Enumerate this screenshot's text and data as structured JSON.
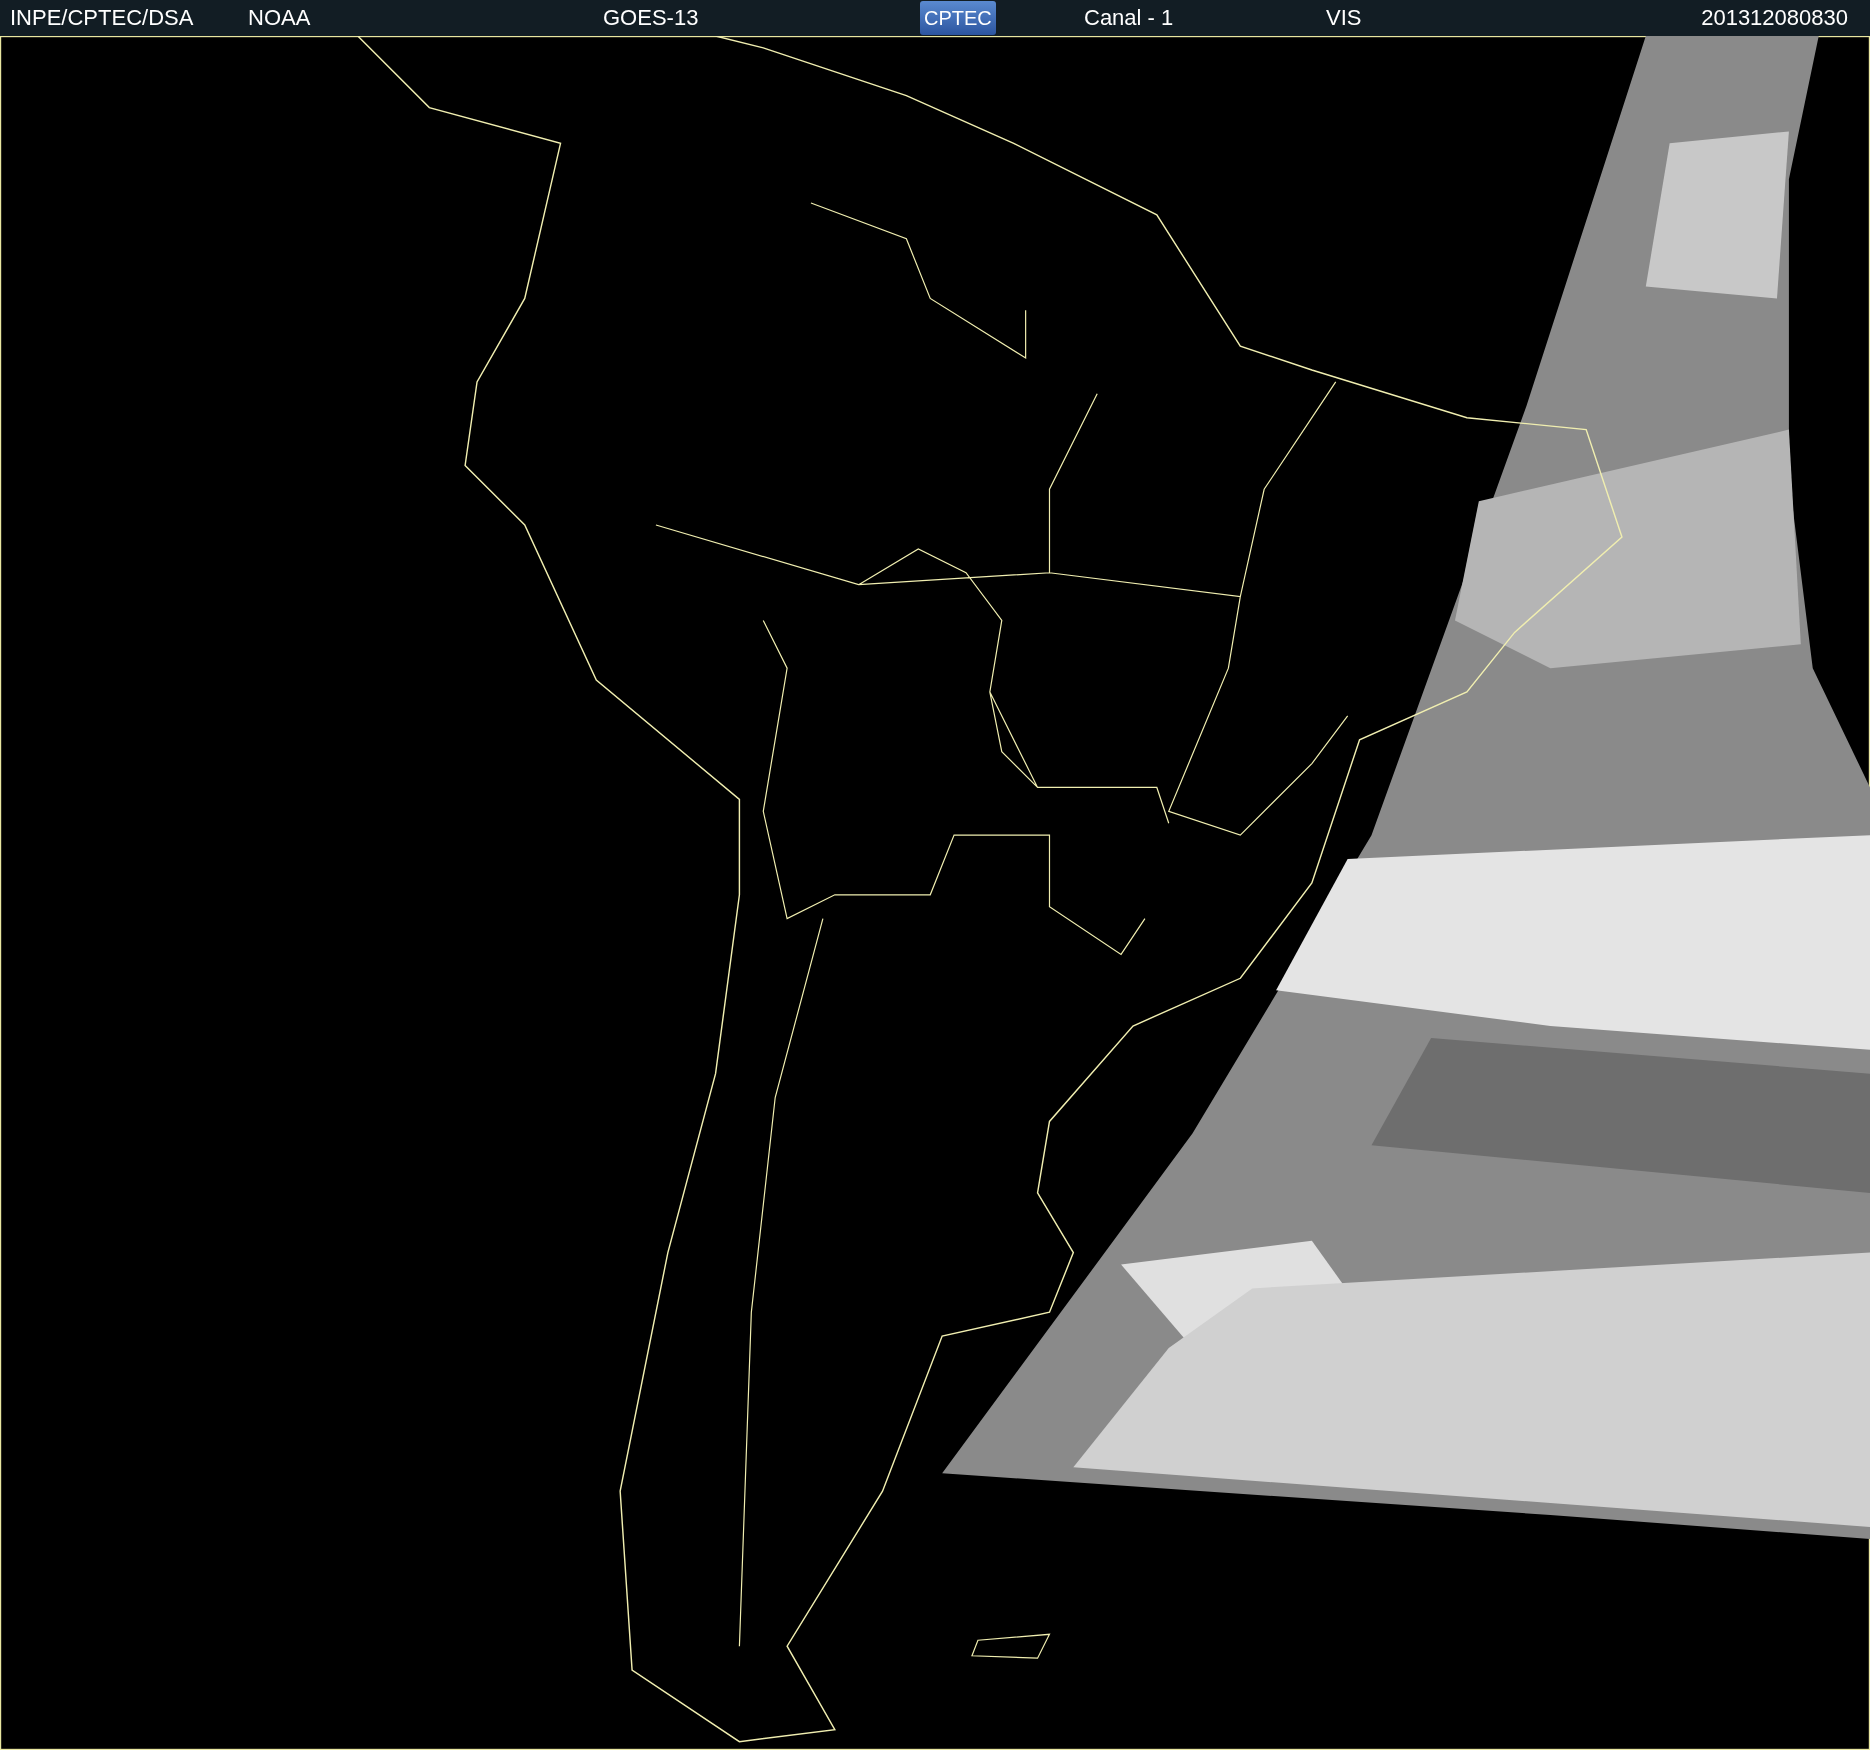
{
  "header": {
    "items": [
      {
        "kind": "text",
        "text": "INPE/CPTEC/DSA"
      },
      {
        "kind": "text",
        "text": "NOAA"
      },
      {
        "kind": "text",
        "text": "GOES-13"
      },
      {
        "kind": "logo",
        "text": "CPTEC"
      },
      {
        "kind": "text",
        "text": "Canal - 1"
      },
      {
        "kind": "text",
        "text": "VIS"
      },
      {
        "kind": "text",
        "text": "201312080830"
      }
    ]
  }
}
